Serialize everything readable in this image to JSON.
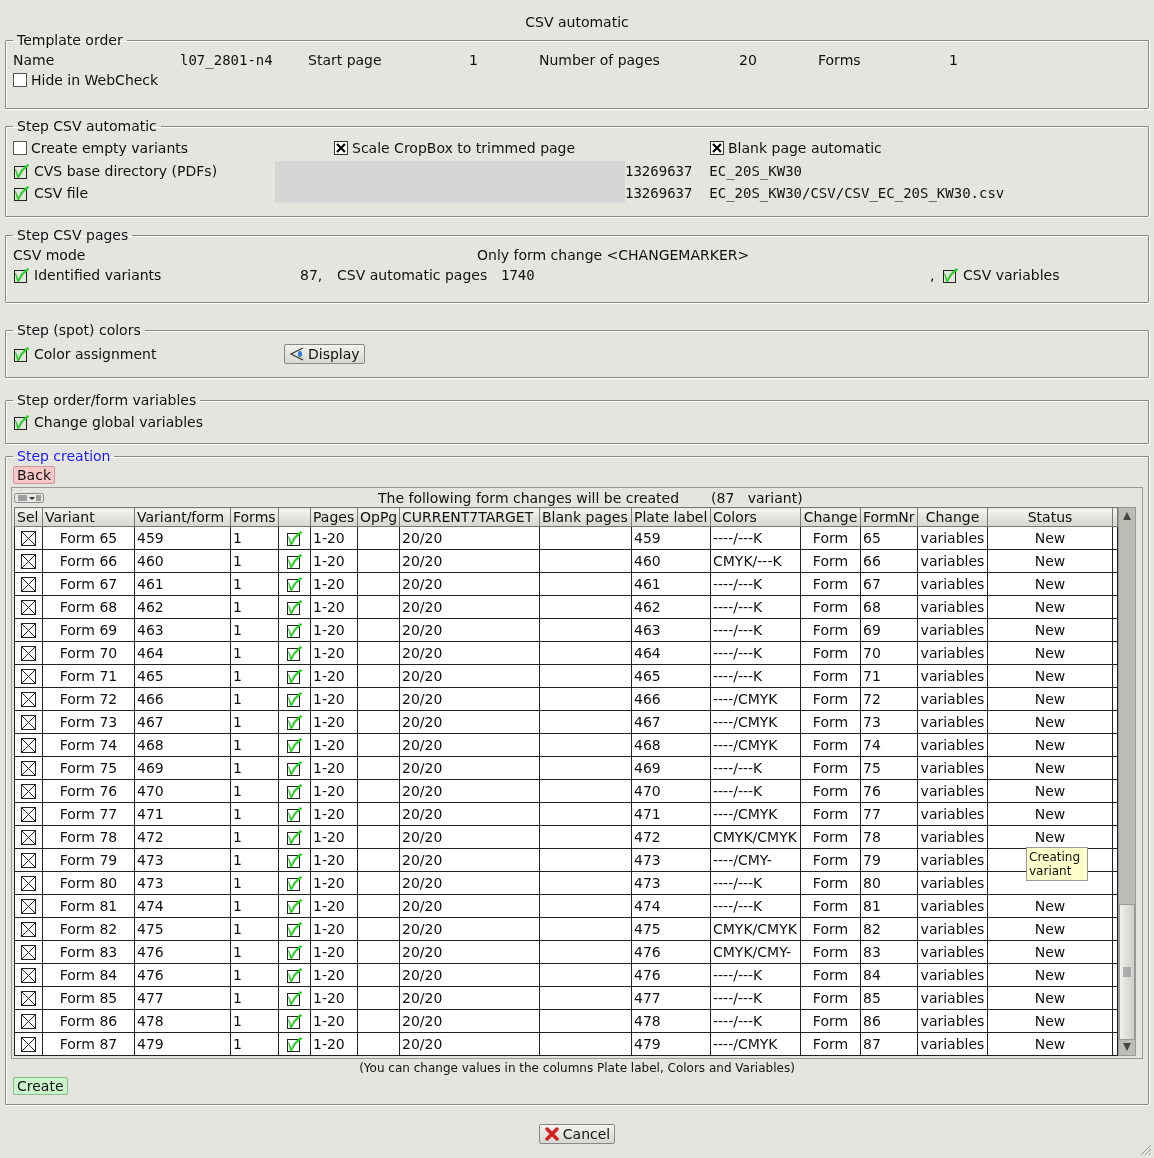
{
  "window": {
    "title": "CSV automatic"
  },
  "template_order": {
    "title": "Template order",
    "fields": [
      {
        "label": "Name",
        "value": "l07_2801-n4"
      },
      {
        "label": "Start page",
        "value": "1"
      },
      {
        "label": "Number of pages",
        "value": "20"
      },
      {
        "label": "Forms",
        "value": "1"
      }
    ],
    "hide_in_webcheck": {
      "label": "Hide in WebCheck",
      "checked": false
    }
  },
  "csv_automatic": {
    "title": "Step CSV automatic",
    "options": [
      {
        "label": "Create empty variants",
        "checked": false
      },
      {
        "label": "Scale CropBox to trimmed page",
        "checked": true,
        "kind": "cross"
      },
      {
        "label": "Blank page automatic",
        "checked": true,
        "kind": "cross"
      }
    ],
    "paths": [
      {
        "label": "CVS base directory (PDFs)",
        "checked": true,
        "kind": "tick",
        "value": "13269637  EC_20S_KW30"
      },
      {
        "label": "CSV file",
        "checked": true,
        "kind": "tick",
        "value": "13269637  EC_20S_KW30/CSV/CSV_EC_20S_KW30.csv"
      }
    ]
  },
  "csv_pages": {
    "title": "Step CSV pages",
    "mode_label": "CSV mode",
    "mode_value": "Only form change <CHANGEMARKER>",
    "identified": {
      "label": "Identified variants",
      "checked": true,
      "kind": "tick"
    },
    "variants_count": "87,",
    "pages_label": "CSV automatic pages",
    "pages_value": "1740",
    "separator": ",",
    "csv_variables": {
      "label": "CSV variables",
      "checked": true,
      "kind": "tick"
    }
  },
  "spot_colors": {
    "title": "Step (spot) colors",
    "assignment": {
      "label": "Color assignment",
      "checked": true,
      "kind": "tick"
    },
    "display_button": "Display"
  },
  "order_variables": {
    "title": "Step order/form variables",
    "global": {
      "label": "Change global variables",
      "checked": true,
      "kind": "tick"
    }
  },
  "creation": {
    "title": "Step creation",
    "back_button": "Back",
    "caption": "The following form changes will be created",
    "count": "(87   variant)",
    "columns": [
      {
        "kind": "text",
        "label": "Sel"
      },
      {
        "kind": "text",
        "label": "Variant"
      },
      {
        "kind": "text",
        "label": "Variant/form"
      },
      {
        "kind": "text",
        "label": "Forms"
      },
      {
        "kind": "check"
      },
      {
        "kind": "text",
        "label": "Pages"
      },
      {
        "kind": "text",
        "label": "OpPg"
      },
      {
        "kind": "text",
        "label": "CURRENT7TARGET"
      },
      {
        "kind": "text",
        "label": "Blank pages"
      },
      {
        "kind": "text",
        "label": "Plate label"
      },
      {
        "kind": "text",
        "label": "Colors"
      },
      {
        "kind": "text",
        "label": "Change"
      },
      {
        "kind": "text",
        "label": "FormNr"
      },
      {
        "kind": "text",
        "label": "Change"
      },
      {
        "kind": "text",
        "label": "Status"
      }
    ],
    "rows": [
      {
        "sel": true,
        "variant": "Form 65",
        "variant_form": "459",
        "forms": "1",
        "checked": true,
        "pages": "1-20",
        "target": "20/20",
        "plate_label": "459",
        "colors": "----/---K",
        "change": "Form",
        "form_nr": "65",
        "change_2": "variables",
        "status": "New"
      },
      {
        "sel": true,
        "variant": "Form 66",
        "variant_form": "460",
        "forms": "1",
        "checked": true,
        "pages": "1-20",
        "target": "20/20",
        "plate_label": "460",
        "colors": "CMYK/---K",
        "change": "Form",
        "form_nr": "66",
        "change_2": "variables",
        "status": "New"
      },
      {
        "sel": true,
        "variant": "Form 67",
        "variant_form": "461",
        "forms": "1",
        "checked": true,
        "pages": "1-20",
        "target": "20/20",
        "plate_label": "461",
        "colors": "----/---K",
        "change": "Form",
        "form_nr": "67",
        "change_2": "variables",
        "status": "New"
      },
      {
        "sel": true,
        "variant": "Form 68",
        "variant_form": "462",
        "forms": "1",
        "checked": true,
        "pages": "1-20",
        "target": "20/20",
        "plate_label": "462",
        "colors": "----/---K",
        "change": "Form",
        "form_nr": "68",
        "change_2": "variables",
        "status": "New"
      },
      {
        "sel": true,
        "variant": "Form 69",
        "variant_form": "463",
        "forms": "1",
        "checked": true,
        "pages": "1-20",
        "target": "20/20",
        "plate_label": "463",
        "colors": "----/---K",
        "change": "Form",
        "form_nr": "69",
        "change_2": "variables",
        "status": "New"
      },
      {
        "sel": true,
        "variant": "Form 70",
        "variant_form": "464",
        "forms": "1",
        "checked": true,
        "pages": "1-20",
        "target": "20/20",
        "plate_label": "464",
        "colors": "----/---K",
        "change": "Form",
        "form_nr": "70",
        "change_2": "variables",
        "status": "New"
      },
      {
        "sel": true,
        "variant": "Form 71",
        "variant_form": "465",
        "forms": "1",
        "checked": true,
        "pages": "1-20",
        "target": "20/20",
        "plate_label": "465",
        "colors": "----/---K",
        "change": "Form",
        "form_nr": "71",
        "change_2": "variables",
        "status": "New"
      },
      {
        "sel": true,
        "variant": "Form 72",
        "variant_form": "466",
        "forms": "1",
        "checked": true,
        "pages": "1-20",
        "target": "20/20",
        "plate_label": "466",
        "colors": "----/CMYK",
        "change": "Form",
        "form_nr": "72",
        "change_2": "variables",
        "status": "New"
      },
      {
        "sel": true,
        "variant": "Form 73",
        "variant_form": "467",
        "forms": "1",
        "checked": true,
        "pages": "1-20",
        "target": "20/20",
        "plate_label": "467",
        "colors": "----/CMYK",
        "change": "Form",
        "form_nr": "73",
        "change_2": "variables",
        "status": "New"
      },
      {
        "sel": true,
        "variant": "Form 74",
        "variant_form": "468",
        "forms": "1",
        "checked": true,
        "pages": "1-20",
        "target": "20/20",
        "plate_label": "468",
        "colors": "----/CMYK",
        "change": "Form",
        "form_nr": "74",
        "change_2": "variables",
        "status": "New"
      },
      {
        "sel": true,
        "variant": "Form 75",
        "variant_form": "469",
        "forms": "1",
        "checked": true,
        "pages": "1-20",
        "target": "20/20",
        "plate_label": "469",
        "colors": "----/---K",
        "change": "Form",
        "form_nr": "75",
        "change_2": "variables",
        "status": "New"
      },
      {
        "sel": true,
        "variant": "Form 76",
        "variant_form": "470",
        "forms": "1",
        "checked": true,
        "pages": "1-20",
        "target": "20/20",
        "plate_label": "470",
        "colors": "----/---K",
        "change": "Form",
        "form_nr": "76",
        "change_2": "variables",
        "status": "New"
      },
      {
        "sel": true,
        "variant": "Form 77",
        "variant_form": "471",
        "forms": "1",
        "checked": true,
        "pages": "1-20",
        "target": "20/20",
        "plate_label": "471",
        "colors": "----/CMYK",
        "change": "Form",
        "form_nr": "77",
        "change_2": "variables",
        "status": "New"
      },
      {
        "sel": true,
        "variant": "Form 78",
        "variant_form": "472",
        "forms": "1",
        "checked": true,
        "pages": "1-20",
        "target": "20/20",
        "plate_label": "472",
        "colors": "CMYK/CMYK",
        "change": "Form",
        "form_nr": "78",
        "change_2": "variables",
        "status": "New"
      },
      {
        "sel": true,
        "variant": "Form 79",
        "variant_form": "473",
        "forms": "1",
        "checked": true,
        "pages": "1-20",
        "target": "20/20",
        "plate_label": "473",
        "colors": "----/CMY-",
        "change": "Form",
        "form_nr": "79",
        "change_2": "variables"
      },
      {
        "sel": true,
        "variant": "Form 80",
        "variant_form": "473",
        "forms": "1",
        "checked": true,
        "pages": "1-20",
        "target": "20/20",
        "plate_label": "473",
        "colors": "----/---K",
        "change": "Form",
        "form_nr": "80",
        "change_2": "variables"
      },
      {
        "sel": true,
        "variant": "Form 81",
        "variant_form": "474",
        "forms": "1",
        "checked": true,
        "pages": "1-20",
        "target": "20/20",
        "plate_label": "474",
        "colors": "----/---K",
        "change": "Form",
        "form_nr": "81",
        "change_2": "variables",
        "status": "New"
      },
      {
        "sel": true,
        "variant": "Form 82",
        "variant_form": "475",
        "forms": "1",
        "checked": true,
        "pages": "1-20",
        "target": "20/20",
        "plate_label": "475",
        "colors": "CMYK/CMYK",
        "change": "Form",
        "form_nr": "82",
        "change_2": "variables",
        "status": "New"
      },
      {
        "sel": true,
        "variant": "Form 83",
        "variant_form": "476",
        "forms": "1",
        "checked": true,
        "pages": "1-20",
        "target": "20/20",
        "plate_label": "476",
        "colors": "CMYK/CMY-",
        "change": "Form",
        "form_nr": "83",
        "change_2": "variables",
        "status": "New"
      },
      {
        "sel": true,
        "variant": "Form 84",
        "variant_form": "476",
        "forms": "1",
        "checked": true,
        "pages": "1-20",
        "target": "20/20",
        "plate_label": "476",
        "colors": "----/---K",
        "change": "Form",
        "form_nr": "84",
        "change_2": "variables",
        "status": "New"
      },
      {
        "sel": true,
        "variant": "Form 85",
        "variant_form": "477",
        "forms": "1",
        "checked": true,
        "pages": "1-20",
        "target": "20/20",
        "plate_label": "477",
        "colors": "----/---K",
        "change": "Form",
        "form_nr": "85",
        "change_2": "variables",
        "status": "New"
      },
      {
        "sel": true,
        "variant": "Form 86",
        "variant_form": "478",
        "forms": "1",
        "checked": true,
        "pages": "1-20",
        "target": "20/20",
        "plate_label": "478",
        "colors": "----/---K",
        "change": "Form",
        "form_nr": "86",
        "change_2": "variables",
        "status": "New"
      },
      {
        "sel": true,
        "variant": "Form 87",
        "variant_form": "479",
        "forms": "1",
        "checked": true,
        "pages": "1-20",
        "target": "20/20",
        "plate_label": "479",
        "colors": "----/CMYK",
        "change": "Form",
        "form_nr": "87",
        "change_2": "variables",
        "status": "New"
      }
    ],
    "tooltip": "Creating variant",
    "note": "(You can change values in the columns Plate label, Colors and Variables)",
    "create_button": "Create"
  },
  "cancel_button": "Cancel"
}
